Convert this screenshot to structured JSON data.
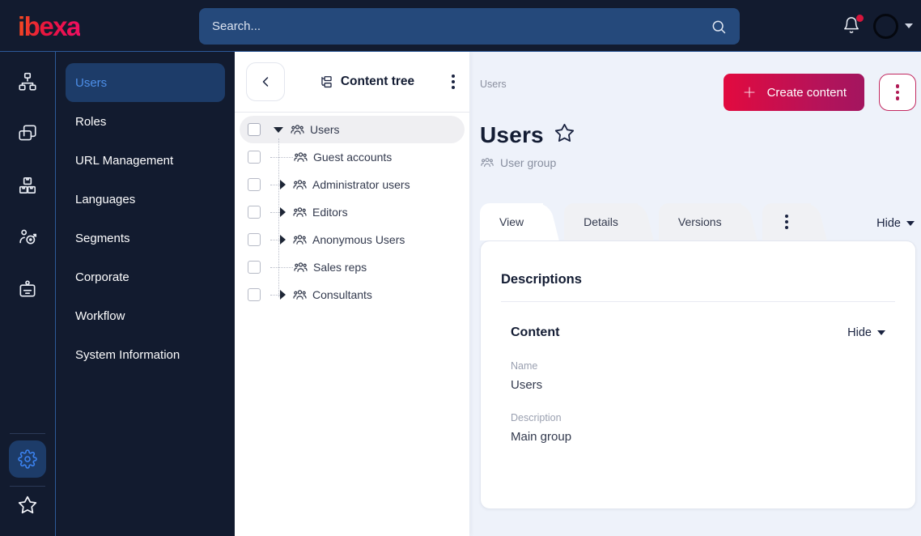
{
  "topbar": {
    "logo_text": "ibexa",
    "search_placeholder": "Search...",
    "icons": [
      "search-icon",
      "bell-icon",
      "avatar",
      "chevron-down-icon"
    ],
    "notification_unread": true
  },
  "rail": {
    "top_icons": [
      "sitemap-icon",
      "pages-icon",
      "packages-icon",
      "personalization-icon",
      "badge-icon"
    ],
    "bottom_icons": [
      "gear-icon",
      "star-icon"
    ],
    "active_icon": "gear-icon"
  },
  "sidebar": {
    "items": [
      {
        "label": "Users",
        "active": true
      },
      {
        "label": "Roles",
        "active": false
      },
      {
        "label": "URL Management",
        "active": false
      },
      {
        "label": "Languages",
        "active": false
      },
      {
        "label": "Segments",
        "active": false
      },
      {
        "label": "Corporate",
        "active": false
      },
      {
        "label": "Workflow",
        "active": false
      },
      {
        "label": "System Information",
        "active": false
      }
    ]
  },
  "content_tree": {
    "title": "Content tree",
    "items": [
      {
        "label": "Users",
        "state": "expanded",
        "selected": true,
        "level": 0
      },
      {
        "label": "Guest accounts",
        "state": "leaf",
        "selected": false,
        "level": 1
      },
      {
        "label": "Administrator users",
        "state": "collapsed",
        "selected": false,
        "level": 1
      },
      {
        "label": "Editors",
        "state": "collapsed",
        "selected": false,
        "level": 1
      },
      {
        "label": "Anonymous Users",
        "state": "collapsed",
        "selected": false,
        "level": 1
      },
      {
        "label": "Sales reps",
        "state": "leaf",
        "selected": false,
        "level": 1
      },
      {
        "label": "Consultants",
        "state": "collapsed",
        "selected": false,
        "level": 1
      }
    ]
  },
  "main": {
    "breadcrumb": "Users",
    "create_button_label": "Create content",
    "title": "Users",
    "content_type": "User group",
    "tabs": [
      {
        "label": "View",
        "active": true
      },
      {
        "label": "Details",
        "active": false
      },
      {
        "label": "Versions",
        "active": false
      }
    ],
    "hide_label": "Hide",
    "card": {
      "heading": "Descriptions",
      "section": {
        "heading": "Content",
        "hide_label": "Hide",
        "fields": [
          {
            "label": "Name",
            "value": "Users"
          },
          {
            "label": "Description",
            "value": "Main group"
          }
        ]
      }
    }
  },
  "colors": {
    "topbar_bg": "#121b2f",
    "accent_line": "#2d5a99",
    "selected_item_bg": "#1d3c69",
    "selected_item_text": "#4d8fe8",
    "brand_gradient_start": "#e20a3f",
    "brand_gradient_end": "#a3155f",
    "notification_dot": "#d6153c",
    "main_bg": "#eef2fa"
  }
}
